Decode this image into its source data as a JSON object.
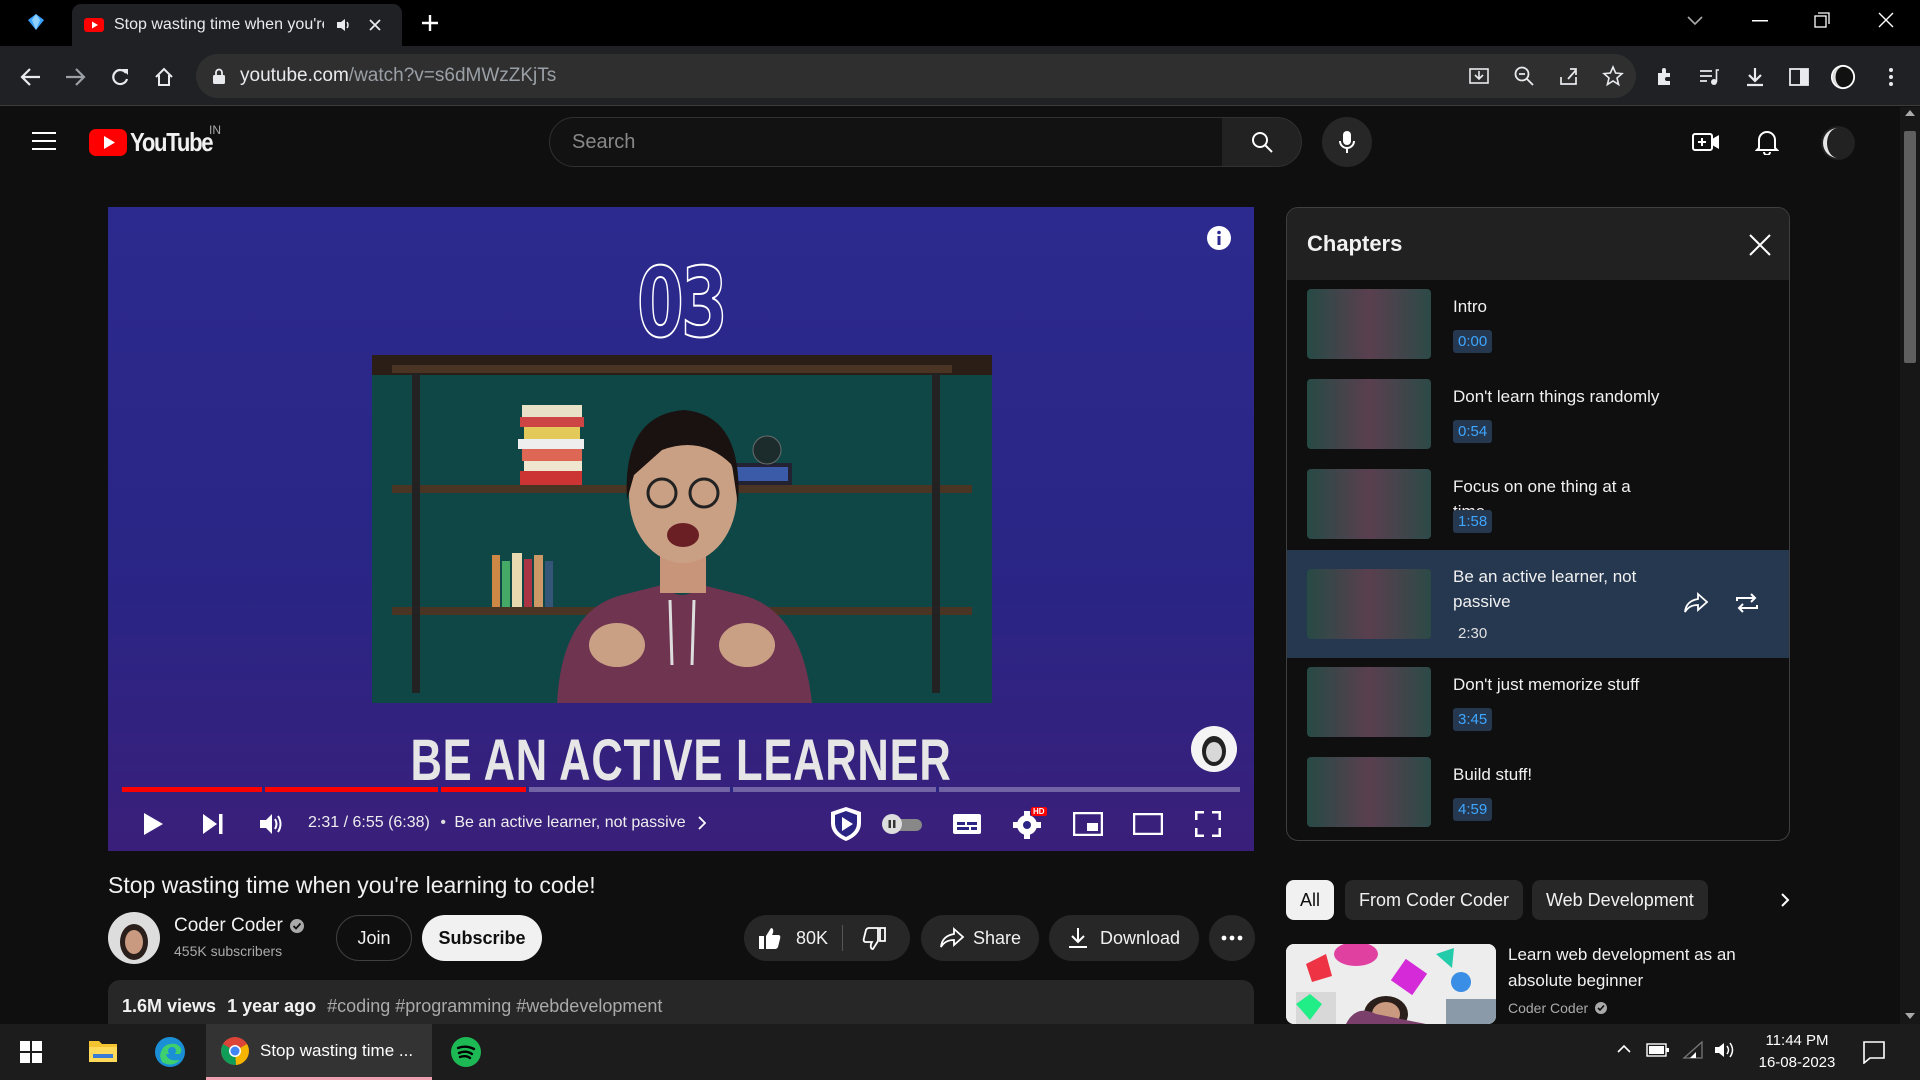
{
  "browser": {
    "tab_title": "Stop wasting time when you're learning to code!",
    "url_host": "youtube.com",
    "url_path": "/watch?v=s6dMWzZKjTs"
  },
  "yt": {
    "logo_text": "YouTube",
    "region": "IN",
    "search_placeholder": "Search"
  },
  "player": {
    "big_number": "03",
    "headline": "BE AN ACTIVE LEARNER",
    "time": "2:31 / 6:55 (6:38)",
    "chapter_label": "Be an active learner, not passive",
    "progress": 0.363,
    "hd_badge": "HD"
  },
  "chapters_panel": {
    "title": "Chapters",
    "items": [
      {
        "title": "Intro",
        "time": "0:00"
      },
      {
        "title": "Don't learn things randomly",
        "time": "0:54"
      },
      {
        "title": "Focus on one thing at a time",
        "time": "1:58"
      },
      {
        "title": "Be an active learner, not passive",
        "time": "2:30"
      },
      {
        "title": "Don't just memorize stuff",
        "time": "3:45"
      },
      {
        "title": "Build stuff!",
        "time": "4:59"
      }
    ]
  },
  "video": {
    "title": "Stop wasting time when you're learning to code!",
    "channel": "Coder Coder",
    "subscribers": "455K subscribers",
    "join": "Join",
    "subscribe": "Subscribe",
    "likes": "80K",
    "share": "Share",
    "download": "Download",
    "views": "1.6M views",
    "age": "1 year ago",
    "hashtags": "#coding #programming #webdevelopment"
  },
  "chips": [
    "All",
    "From Coder Coder",
    "Web Development"
  ],
  "recommended": {
    "title": "Learn web development as an absolute beginner",
    "channel": "Coder Coder"
  },
  "taskbar": {
    "chrome_label": "Stop wasting time ...",
    "time": "11:44 PM",
    "date": "16-08-2023"
  },
  "colors": {
    "accent": "#ff0000",
    "chapter_active": "#263850",
    "link": "#3ea6ff"
  }
}
